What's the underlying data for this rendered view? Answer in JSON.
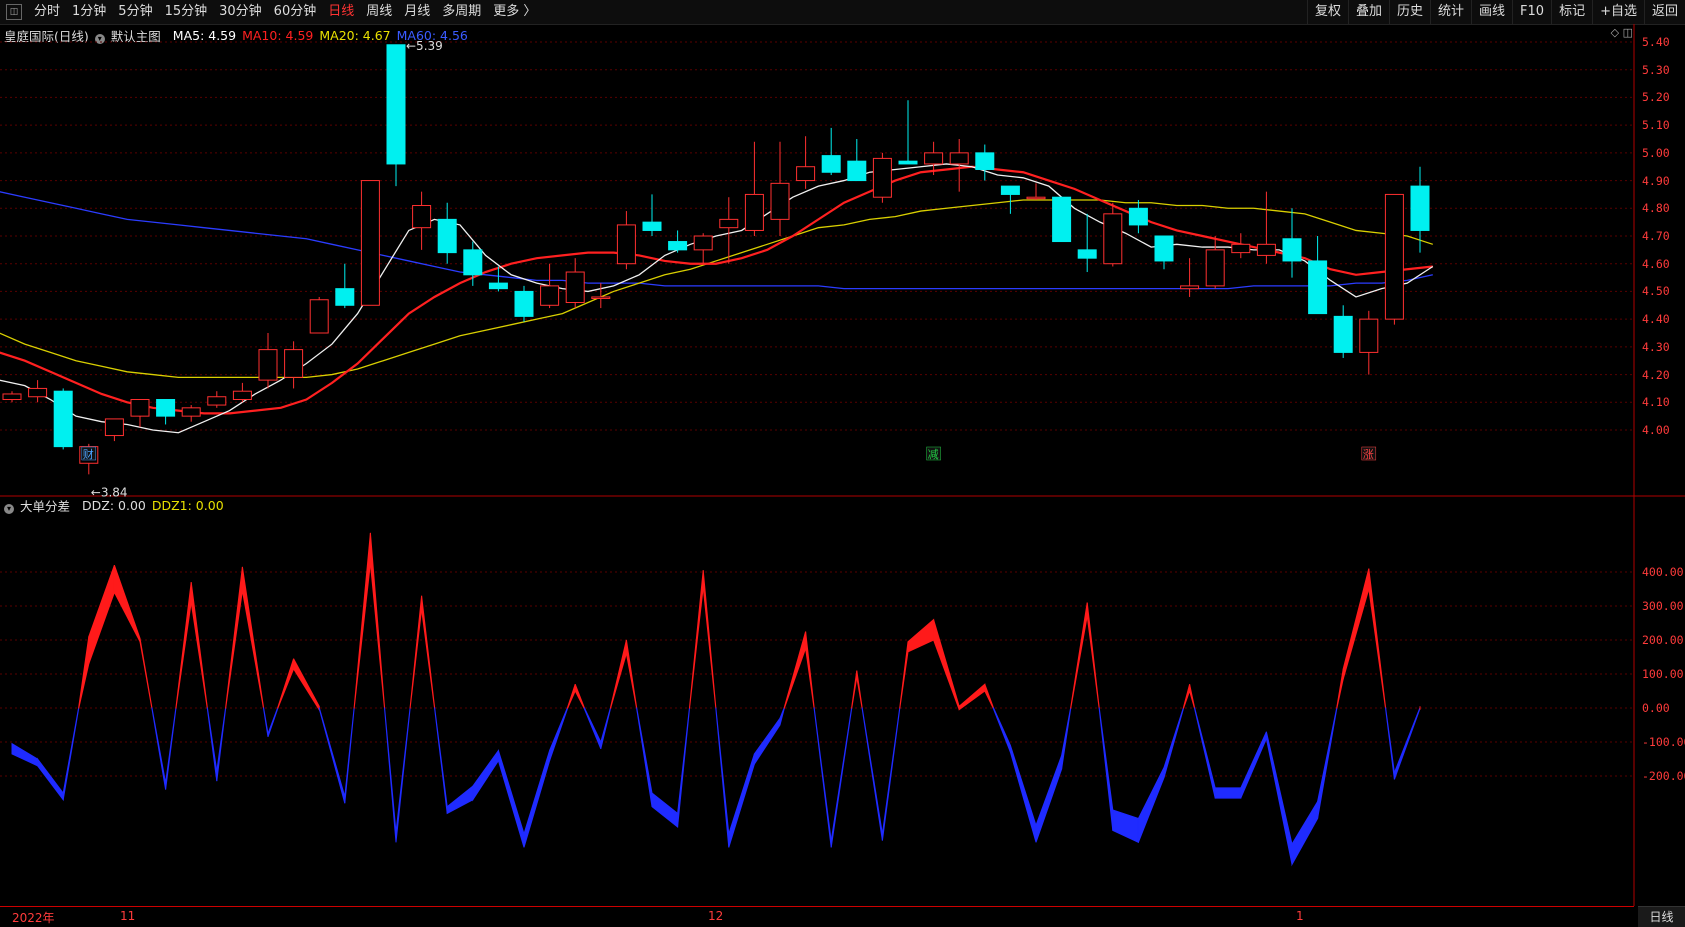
{
  "toolbar": {
    "timeframes": [
      "分时",
      "1分钟",
      "5分钟",
      "15分钟",
      "30分钟",
      "60分钟",
      "日线",
      "周线",
      "月线",
      "多周期",
      "更多 〉"
    ],
    "active": "日线",
    "actions": [
      "复权",
      "叠加",
      "历史",
      "统计",
      "画线",
      "F10",
      "标记",
      "+自选",
      "返回"
    ]
  },
  "main_panel": {
    "stock": "皇庭国际(日线)",
    "template": "默认主图",
    "ma": [
      {
        "label": "MA5: 4.59",
        "color": "#ffffff"
      },
      {
        "label": "MA10: 4.59",
        "color": "#ff2020"
      },
      {
        "label": "MA20: 4.67",
        "color": "#e8e000"
      },
      {
        "label": "MA60: 4.56",
        "color": "#3a5bff"
      }
    ],
    "high_label": "5.39",
    "low_label": "3.84",
    "axis": [
      "5.40",
      "5.30",
      "5.20",
      "5.10",
      "5.00",
      "4.90",
      "4.80",
      "4.70",
      "4.60",
      "4.50",
      "4.40",
      "4.30",
      "4.20",
      "4.10",
      "4.00"
    ],
    "markers": [
      {
        "text": "财",
        "color": "#4da3ff"
      },
      {
        "text": "减",
        "color": "#22cc44"
      },
      {
        "text": "涨",
        "color": "#ff4444"
      }
    ]
  },
  "sub_panel": {
    "name": "大单分差",
    "ddz": "DDZ: 0.00",
    "ddz1": "DDZ1: 0.00",
    "axis": [
      "400.00",
      "300.00",
      "200.00",
      "100.00",
      "0.00",
      "-100.00",
      "-200.00"
    ]
  },
  "date_axis": [
    "2022年",
    "11",
    "12",
    "1"
  ],
  "period_button": "日线",
  "chart_data": {
    "type": "candlestick",
    "ohlc": [
      [
        4.11,
        4.14,
        4.1,
        4.13
      ],
      [
        4.12,
        4.18,
        4.1,
        4.15
      ],
      [
        4.14,
        4.15,
        3.93,
        3.94
      ],
      [
        3.88,
        3.95,
        3.84,
        3.94
      ],
      [
        3.98,
        4.02,
        3.96,
        4.04
      ],
      [
        4.05,
        4.1,
        4.01,
        4.11
      ],
      [
        4.11,
        4.11,
        4.02,
        4.05
      ],
      [
        4.05,
        4.09,
        4.03,
        4.08
      ],
      [
        4.09,
        4.14,
        4.08,
        4.12
      ],
      [
        4.11,
        4.17,
        4.1,
        4.14
      ],
      [
        4.18,
        4.35,
        4.15,
        4.29
      ],
      [
        4.19,
        4.32,
        4.15,
        4.29
      ],
      [
        4.35,
        4.48,
        4.35,
        4.47
      ],
      [
        4.51,
        4.6,
        4.44,
        4.45
      ],
      [
        4.45,
        4.9,
        4.45,
        4.9
      ],
      [
        5.39,
        5.39,
        4.88,
        4.96
      ],
      [
        4.73,
        4.86,
        4.65,
        4.81
      ],
      [
        4.76,
        4.82,
        4.6,
        4.64
      ],
      [
        4.65,
        4.68,
        4.52,
        4.56
      ],
      [
        4.53,
        4.59,
        4.5,
        4.51
      ],
      [
        4.5,
        4.52,
        4.39,
        4.41
      ],
      [
        4.45,
        4.6,
        4.44,
        4.52
      ],
      [
        4.46,
        4.62,
        4.44,
        4.57
      ],
      [
        4.48,
        4.53,
        4.44,
        4.48
      ],
      [
        4.6,
        4.79,
        4.58,
        4.74
      ],
      [
        4.75,
        4.85,
        4.7,
        4.72
      ],
      [
        4.68,
        4.72,
        4.64,
        4.65
      ],
      [
        4.65,
        4.71,
        4.6,
        4.7
      ],
      [
        4.73,
        4.84,
        4.6,
        4.76
      ],
      [
        4.72,
        5.04,
        4.7,
        4.85
      ],
      [
        4.76,
        5.04,
        4.7,
        4.89
      ],
      [
        4.9,
        5.06,
        4.87,
        4.95
      ],
      [
        4.99,
        5.09,
        4.92,
        4.93
      ],
      [
        4.97,
        5.05,
        4.9,
        4.9
      ],
      [
        4.84,
        5.0,
        4.82,
        4.98
      ],
      [
        4.97,
        5.19,
        4.96,
        4.96
      ],
      [
        4.96,
        5.04,
        4.92,
        5.0
      ],
      [
        4.96,
        5.05,
        4.86,
        5.0
      ],
      [
        5.0,
        5.03,
        4.9,
        4.94
      ],
      [
        4.88,
        4.88,
        4.78,
        4.85
      ],
      [
        4.84,
        4.89,
        4.83,
        4.84
      ],
      [
        4.84,
        4.84,
        4.79,
        4.68
      ],
      [
        4.65,
        4.78,
        4.57,
        4.62
      ],
      [
        4.6,
        4.82,
        4.59,
        4.78
      ],
      [
        4.8,
        4.83,
        4.71,
        4.74
      ],
      [
        4.7,
        4.7,
        4.58,
        4.61
      ],
      [
        4.51,
        4.62,
        4.48,
        4.52
      ],
      [
        4.52,
        4.7,
        4.51,
        4.65
      ],
      [
        4.64,
        4.71,
        4.62,
        4.67
      ],
      [
        4.63,
        4.86,
        4.6,
        4.67
      ],
      [
        4.69,
        4.8,
        4.55,
        4.61
      ],
      [
        4.61,
        4.7,
        4.54,
        4.42
      ],
      [
        4.41,
        4.45,
        4.26,
        4.28
      ],
      [
        4.28,
        4.43,
        4.2,
        4.4
      ],
      [
        4.4,
        4.85,
        4.38,
        4.85
      ],
      [
        4.88,
        4.95,
        4.64,
        4.72
      ]
    ],
    "ma5": [
      4.18,
      4.16,
      4.11,
      4.05,
      4.03,
      4.02,
      4.0,
      3.99,
      4.03,
      4.07,
      4.13,
      4.18,
      4.24,
      4.31,
      4.42,
      4.57,
      4.72,
      4.76,
      4.74,
      4.63,
      4.56,
      4.53,
      4.51,
      4.5,
      4.52,
      4.56,
      4.63,
      4.67,
      4.7,
      4.72,
      4.78,
      4.84,
      4.88,
      4.9,
      4.93,
      4.94,
      4.95,
      4.96,
      4.95,
      4.92,
      4.91,
      4.88,
      4.8,
      4.75,
      4.71,
      4.66,
      4.67,
      4.66,
      4.66,
      4.65,
      4.65,
      4.61,
      4.54,
      4.48,
      4.51,
      4.53,
      4.59
    ],
    "ma10": [
      4.28,
      4.25,
      4.21,
      4.17,
      4.13,
      4.1,
      4.08,
      4.07,
      4.06,
      4.06,
      4.07,
      4.08,
      4.11,
      4.17,
      4.24,
      4.33,
      4.42,
      4.48,
      4.53,
      4.57,
      4.6,
      4.62,
      4.63,
      4.64,
      4.64,
      4.63,
      4.61,
      4.6,
      4.6,
      4.62,
      4.65,
      4.7,
      4.76,
      4.82,
      4.86,
      4.9,
      4.93,
      4.94,
      4.95,
      4.94,
      4.93,
      4.9,
      4.87,
      4.83,
      4.79,
      4.75,
      4.72,
      4.7,
      4.68,
      4.66,
      4.64,
      4.62,
      4.58,
      4.56,
      4.57,
      4.58,
      4.59
    ],
    "ma20": [
      4.35,
      4.31,
      4.28,
      4.25,
      4.23,
      4.21,
      4.2,
      4.19,
      4.19,
      4.19,
      4.19,
      4.19,
      4.19,
      4.2,
      4.22,
      4.25,
      4.28,
      4.31,
      4.34,
      4.36,
      4.38,
      4.4,
      4.42,
      4.46,
      4.5,
      4.53,
      4.56,
      4.58,
      4.61,
      4.64,
      4.67,
      4.7,
      4.73,
      4.74,
      4.76,
      4.77,
      4.79,
      4.8,
      4.81,
      4.82,
      4.83,
      4.83,
      4.83,
      4.83,
      4.82,
      4.82,
      4.81,
      4.81,
      4.8,
      4.8,
      4.79,
      4.78,
      4.75,
      4.72,
      4.71,
      4.7,
      4.67
    ],
    "ma60": [
      4.86,
      4.84,
      4.82,
      4.8,
      4.78,
      4.76,
      4.75,
      4.74,
      4.73,
      4.72,
      4.71,
      4.7,
      4.69,
      4.67,
      4.65,
      4.63,
      4.61,
      4.59,
      4.57,
      4.56,
      4.55,
      4.54,
      4.54,
      4.53,
      4.53,
      4.53,
      4.52,
      4.52,
      4.52,
      4.52,
      4.52,
      4.52,
      4.52,
      4.51,
      4.51,
      4.51,
      4.51,
      4.51,
      4.51,
      4.51,
      4.51,
      4.51,
      4.51,
      4.51,
      4.51,
      4.51,
      4.51,
      4.51,
      4.51,
      4.52,
      4.52,
      4.52,
      4.52,
      4.53,
      4.53,
      4.54,
      4.56
    ],
    "ddz": [
      -120,
      -160,
      -260,
      170,
      380,
      200,
      -230,
      340,
      -200,
      380,
      -80,
      130,
      0,
      -270,
      470,
      -380,
      310,
      -300,
      -250,
      -140,
      -390,
      -140,
      60,
      -110,
      180,
      -270,
      -330,
      380,
      -390,
      -150,
      -40,
      200,
      -400,
      100,
      -380,
      180,
      230,
      0,
      60,
      -120,
      -370,
      -160,
      290,
      -330,
      -360,
      -190,
      60,
      -250,
      -250,
      -80,
      -430,
      -300,
      100,
      380,
      -200,
      0
    ],
    "ddz_thick": [
      30,
      20,
      20,
      80,
      80,
      10,
      20,
      60,
      30,
      70,
      10,
      30,
      10,
      20,
      90,
      30,
      40,
      20,
      40,
      30,
      40,
      30,
      20,
      20,
      40,
      40,
      40,
      50,
      40,
      30,
      20,
      50,
      20,
      20,
      20,
      30,
      60,
      10,
      20,
      20,
      50,
      40,
      40,
      60,
      70,
      30,
      20,
      30,
      30,
      20,
      60,
      50,
      30,
      60,
      20,
      10
    ]
  }
}
